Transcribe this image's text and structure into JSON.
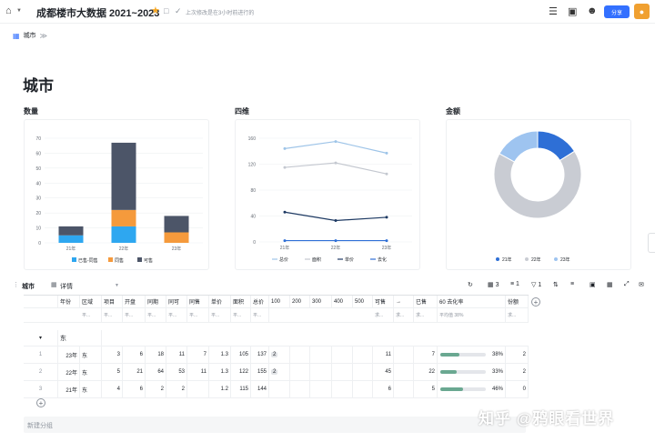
{
  "header": {
    "title": "成都楼市大数据 2021~2023",
    "save_note": "上次修改是在3小时前进行的",
    "share_label": "分享",
    "home_icon": "home-icon",
    "star_color": "#f5a623",
    "share_color": "#3370ff"
  },
  "breadcrumb": {
    "item": "城市",
    "chevron": "≫"
  },
  "page_title": "城市",
  "sections": {
    "count": "数量",
    "price": "四维",
    "amount": "金额"
  },
  "chart_data": [
    {
      "type": "bar",
      "stacked": true,
      "title": "数量",
      "categories": [
        "21年",
        "22年",
        "23年"
      ],
      "ylim": [
        0,
        70
      ],
      "yticks": [
        0,
        10,
        20,
        30,
        40,
        50,
        60,
        70
      ],
      "series": [
        {
          "name": "已售-同售",
          "color": "#2ea7f0",
          "values": [
            5,
            11,
            0
          ]
        },
        {
          "name": "同售",
          "color": "#f59a3c",
          "values": [
            0,
            11,
            7
          ]
        },
        {
          "name": "可售",
          "color": "#4c5568",
          "values": [
            6,
            45,
            11
          ]
        }
      ],
      "legend_position": "bottom"
    },
    {
      "type": "line",
      "title": "四维",
      "categories": [
        "21年",
        "22年",
        "23年"
      ],
      "ylim": [
        0,
        160
      ],
      "yticks": [
        0,
        40,
        80,
        120,
        160
      ],
      "series": [
        {
          "name": "总价",
          "color": "#9ec4e8",
          "values": [
            144,
            155,
            137
          ]
        },
        {
          "name": "面积",
          "color": "#c4c8d0",
          "values": [
            115,
            122,
            105
          ]
        },
        {
          "name": "单价",
          "color": "#1e3a63",
          "values": [
            46,
            33,
            38
          ]
        },
        {
          "name": "去化",
          "color": "#2e6fd6",
          "values": [
            2,
            2,
            2
          ]
        }
      ],
      "legend_position": "bottom"
    },
    {
      "type": "pie",
      "donut": true,
      "title": "金额",
      "categories": [
        "21年",
        "22年",
        "23年"
      ],
      "values": [
        16,
        67,
        17
      ],
      "colors": [
        "#2e6fd6",
        "#c9ccd3",
        "#9ec4f0"
      ],
      "legend_position": "bottom"
    }
  ],
  "table": {
    "name": "城市",
    "view_label": "详情",
    "tools": [
      "3",
      "1",
      "1"
    ],
    "columns": [
      "年份",
      "区域",
      "项目",
      "开盘",
      "同期",
      "同可",
      "同售",
      "单价",
      "面积",
      "总价",
      "100",
      "200",
      "300",
      "400",
      "500",
      "可售",
      "→",
      "已售",
      "60 去化率",
      "份额"
    ],
    "summary": [
      "平...",
      "平...",
      "平...",
      "平...",
      "平...",
      "平...",
      "平...",
      "平...",
      "平...",
      "求...",
      "求...",
      "求...",
      "平均值 38%",
      "求..."
    ],
    "group_label": "东",
    "rows": [
      {
        "idx": "1",
        "year": "23年",
        "area": "东",
        "c1": "3",
        "c2": "6",
        "c3": "18",
        "c4": "11",
        "c5": "7",
        "c6": "1.3",
        "c7": "105",
        "c8": "137",
        "tag": "2",
        "sold": "11",
        "remain": "7",
        "rate": "38%",
        "rate_val": 0.38,
        "share": "2"
      },
      {
        "idx": "2",
        "year": "22年",
        "area": "东",
        "c1": "5",
        "c2": "21",
        "c3": "64",
        "c4": "53",
        "c5": "11",
        "c6": "1.3",
        "c7": "122",
        "c8": "155",
        "tag": "2",
        "sold": "45",
        "remain": "22",
        "rate": "33%",
        "rate_val": 0.33,
        "share": "2"
      },
      {
        "idx": "3",
        "year": "21年",
        "area": "东",
        "c1": "4",
        "c2": "6",
        "c3": "2",
        "c4": "2",
        "c5": "",
        "c6": "1.2",
        "c7": "115",
        "c8": "144",
        "tag": "",
        "sold": "6",
        "remain": "5",
        "rate": "46%",
        "rate_val": 0.46,
        "share": "0"
      }
    ],
    "new_group": "新建分组",
    "bar_color": "#6aa891"
  },
  "watermark": "知乎 @鸦眼看世界"
}
